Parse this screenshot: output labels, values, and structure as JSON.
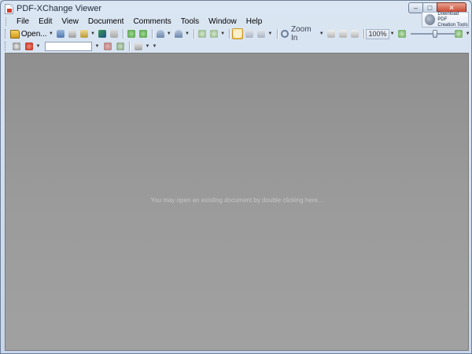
{
  "window": {
    "title": "PDF-XChange Viewer"
  },
  "window_controls": {
    "minimize": "–",
    "maximize": "□",
    "close": "✕"
  },
  "download_badge": {
    "line1": "Download PDF",
    "line2": "Creation Tools"
  },
  "menu": [
    "File",
    "Edit",
    "View",
    "Document",
    "Comments",
    "Tools",
    "Window",
    "Help"
  ],
  "toolbar1": {
    "open_label": "Open...",
    "zoom_in_label": "Zoom In",
    "zoom_value": "100%"
  },
  "toolbar2": {
    "search_value": ""
  },
  "document": {
    "hint": "You may open an existing document by double clicking here..."
  },
  "colors": {
    "doc_background": "#999999",
    "title_bar": "#d3dfee",
    "close_button": "#c4412a"
  }
}
